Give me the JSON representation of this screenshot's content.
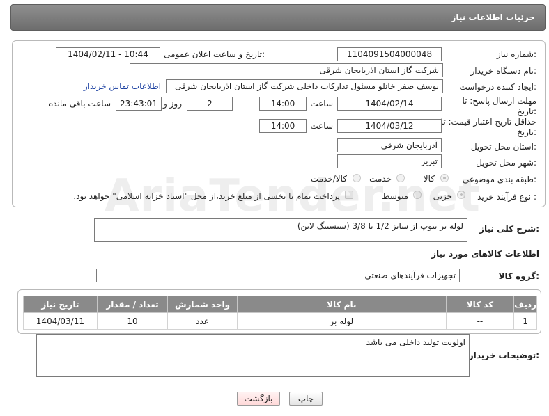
{
  "header": {
    "title": "جزئیات اطلاعات نیاز"
  },
  "form": {
    "need_number_label": "شماره نیاز:",
    "need_number": "1104091504000048",
    "announce_label": "تاریخ و ساعت اعلان عمومی:",
    "announce_value": "1404/02/11 - 10:44",
    "buyer_org_label": "نام دستگاه خریدار:",
    "buyer_org": "شرکت گاز استان اذربایجان شرقی",
    "requester_label": "ایجاد کننده درخواست:",
    "requester": "یوسف صفر خانلو  مسئول تدارکات داخلی  شرکت گاز استان اذربایجان شرقی",
    "buyer_contact_link": "اطلاعات تماس خریدار",
    "reply_deadline_label": "مهلت ارسال پاسخ: تا تاریخ:",
    "reply_date": "1404/02/14",
    "time_label": "ساعت",
    "reply_time": "14:00",
    "days_count": "2",
    "days_label": "روز و",
    "remaining_time": "23:43:01",
    "remaining_label": "ساعت باقی مانده",
    "price_validity_label": "حداقل تاریخ اعتبار قیمت: تا تاریخ:",
    "validity_date": "1404/03/12",
    "validity_time": "14:00",
    "province_label": "استان محل تحویل:",
    "province": "آذربایجان شرقی",
    "city_label": "شهر محل تحویل:",
    "city": "تبریز",
    "category_label": "طبقه بندی موضوعی:",
    "category_options": [
      "کالا",
      "خدمت",
      "کالا/خدمت"
    ],
    "process_label": "نوع فرآیند خرید :",
    "process_options": [
      "جزیی",
      "متوسط"
    ],
    "payment_note": "پرداخت تمام یا بخشی از مبلغ خرید،از محل \"اسناد خزانه اسلامی\" خواهد بود."
  },
  "description": {
    "label": "شرح کلی نیاز:",
    "value": "لوله بر تیوپ از سایز 1/2 تا 3/8 (سنسینگ لاین)"
  },
  "goods": {
    "section_title": "اطلاعات کالاهای مورد نیاز",
    "group_label": "گروه کالا:",
    "group_value": "تجهیزات فرآیندهای صنعتی",
    "columns": [
      "ردیف",
      "کد کالا",
      "نام کالا",
      "واحد شمارش",
      "تعداد / مقدار",
      "تاریخ نیاز"
    ],
    "rows": [
      [
        "1",
        "--",
        "لوله بر",
        "عدد",
        "10",
        "1404/03/11"
      ]
    ]
  },
  "buyer_notes": {
    "label": "توضیحات خریدار:",
    "value": "اولویت تولید داخلی می باشد"
  },
  "buttons": {
    "print": "چاپ",
    "back": "بازگشت"
  },
  "watermark": "AriaTender.net",
  "colors": {
    "header_bg": "#7d7d7d",
    "link": "#1a3fa0",
    "back_button_bg": "#ffe4e4"
  }
}
